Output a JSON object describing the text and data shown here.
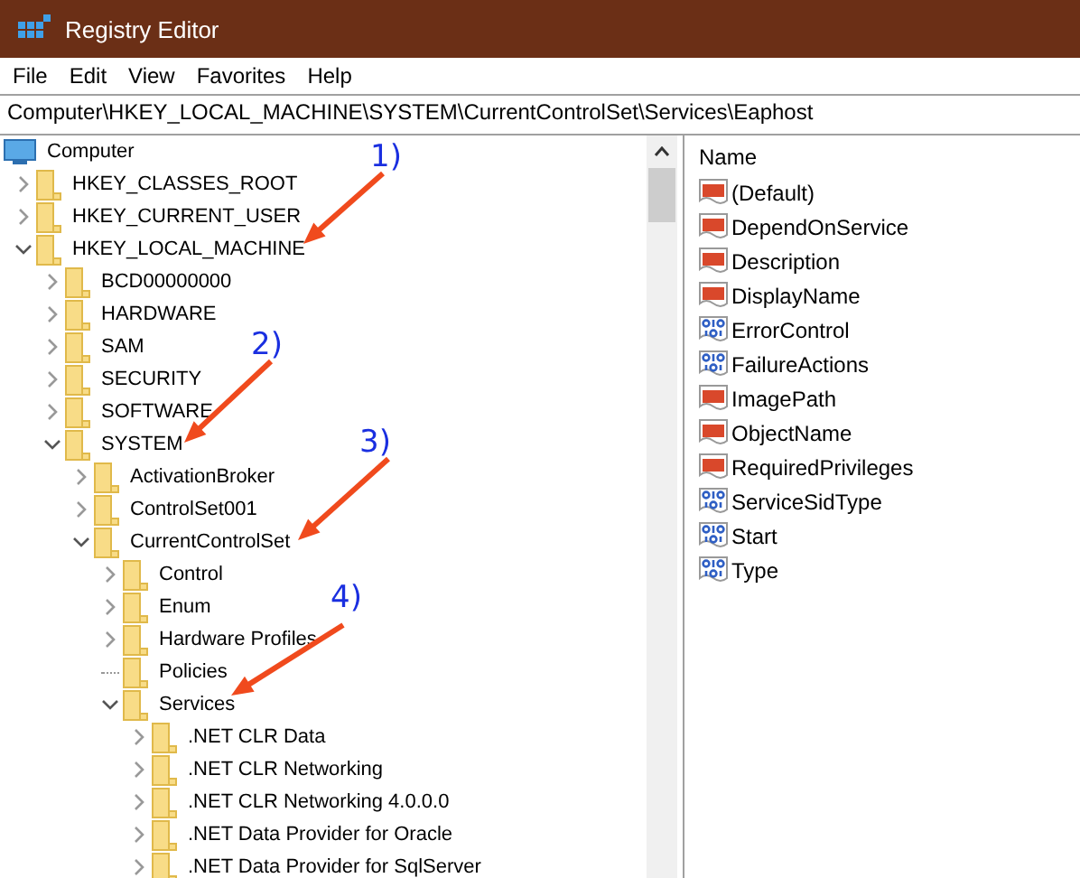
{
  "window": {
    "title": "Registry Editor"
  },
  "menu": [
    "File",
    "Edit",
    "View",
    "Favorites",
    "Help"
  ],
  "address": "Computer\\HKEY_LOCAL_MACHINE\\SYSTEM\\CurrentControlSet\\Services\\Eaphost",
  "tree": [
    {
      "label": "Computer",
      "kind": "root",
      "children": [
        {
          "label": "HKEY_CLASSES_ROOT",
          "kind": "node",
          "expanded": false
        },
        {
          "label": "HKEY_CURRENT_USER",
          "kind": "node",
          "expanded": false
        },
        {
          "label": "HKEY_LOCAL_MACHINE",
          "kind": "node",
          "expanded": true,
          "children": [
            {
              "label": "BCD00000000",
              "kind": "node",
              "expanded": false
            },
            {
              "label": "HARDWARE",
              "kind": "node",
              "expanded": false
            },
            {
              "label": "SAM",
              "kind": "node",
              "expanded": false
            },
            {
              "label": "SECURITY",
              "kind": "node",
              "expanded": false
            },
            {
              "label": "SOFTWARE",
              "kind": "node",
              "expanded": false
            },
            {
              "label": "SYSTEM",
              "kind": "node",
              "expanded": true,
              "children": [
                {
                  "label": "ActivationBroker",
                  "kind": "node",
                  "expanded": false
                },
                {
                  "label": "ControlSet001",
                  "kind": "node",
                  "expanded": false
                },
                {
                  "label": "CurrentControlSet",
                  "kind": "node",
                  "expanded": true,
                  "children": [
                    {
                      "label": "Control",
                      "kind": "node",
                      "expanded": false
                    },
                    {
                      "label": "Enum",
                      "kind": "node",
                      "expanded": false
                    },
                    {
                      "label": "Hardware Profiles",
                      "kind": "node",
                      "expanded": false
                    },
                    {
                      "label": "Policies",
                      "kind": "leaf"
                    },
                    {
                      "label": "Services",
                      "kind": "node",
                      "expanded": true,
                      "children": [
                        {
                          "label": ".NET CLR Data",
                          "kind": "node",
                          "expanded": false
                        },
                        {
                          "label": ".NET CLR Networking",
                          "kind": "node",
                          "expanded": false
                        },
                        {
                          "label": ".NET CLR Networking 4.0.0.0",
                          "kind": "node",
                          "expanded": false
                        },
                        {
                          "label": ".NET Data Provider for Oracle",
                          "kind": "node",
                          "expanded": false
                        },
                        {
                          "label": ".NET Data Provider for SqlServer",
                          "kind": "node",
                          "expanded": false
                        }
                      ]
                    }
                  ]
                }
              ]
            }
          ]
        }
      ]
    }
  ],
  "values": {
    "columns": [
      "Name"
    ],
    "rows": [
      {
        "name": "(Default)",
        "kind": "string"
      },
      {
        "name": "DependOnService",
        "kind": "string"
      },
      {
        "name": "Description",
        "kind": "string"
      },
      {
        "name": "DisplayName",
        "kind": "string"
      },
      {
        "name": "ErrorControl",
        "kind": "binary"
      },
      {
        "name": "FailureActions",
        "kind": "binary"
      },
      {
        "name": "ImagePath",
        "kind": "string"
      },
      {
        "name": "ObjectName",
        "kind": "string"
      },
      {
        "name": "RequiredPrivileges",
        "kind": "string"
      },
      {
        "name": "ServiceSidType",
        "kind": "binary"
      },
      {
        "name": "Start",
        "kind": "binary"
      },
      {
        "name": "Type",
        "kind": "binary"
      }
    ]
  },
  "annotations": [
    {
      "label": "1)"
    },
    {
      "label": "2)"
    },
    {
      "label": "3)"
    },
    {
      "label": "4)"
    }
  ]
}
